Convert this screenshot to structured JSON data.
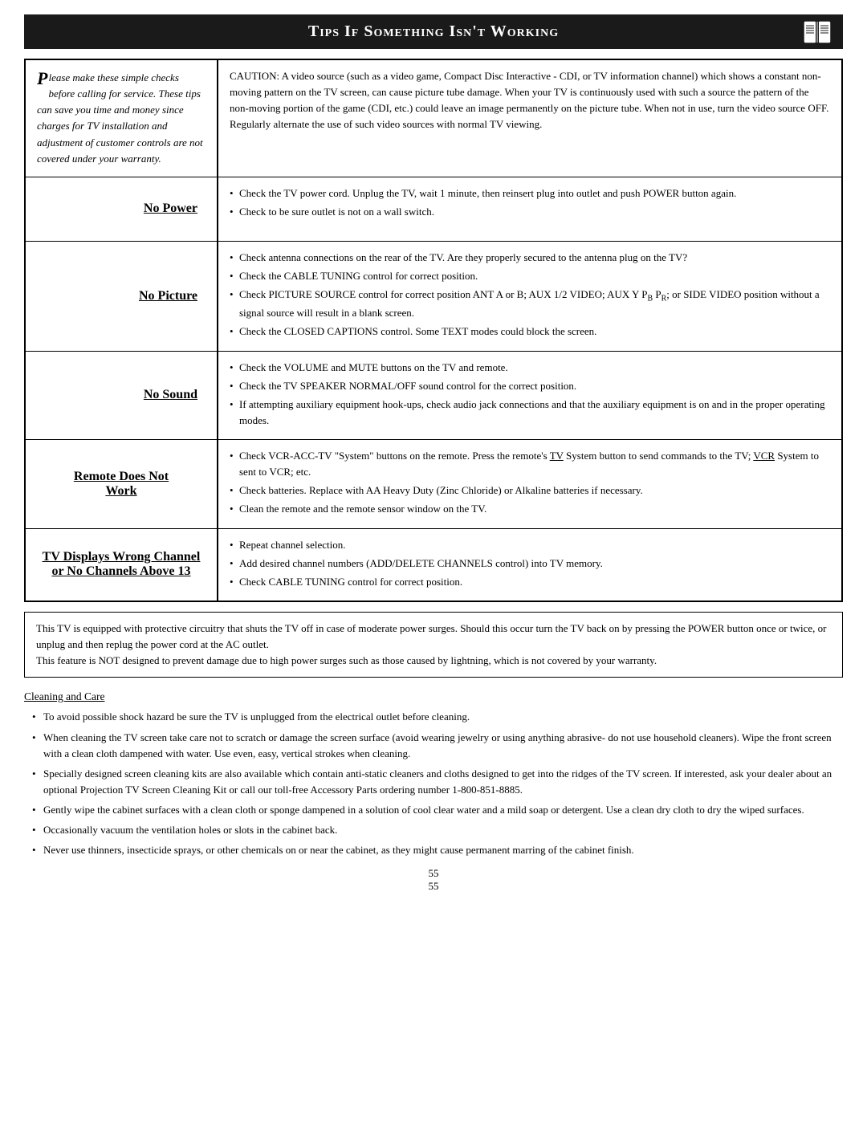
{
  "header": {
    "title": "Tips If Something Isn't Working",
    "icon_label": "book-icon"
  },
  "caution_text": "CAUTION: A video source (such as a video game, Compact Disc Interactive - CDI, or TV information channel) which shows a constant non-moving pattern on the TV screen, can cause picture tube damage. When your TV is continuously used with such a source the pattern of the non-moving portion of the game (CDI, etc.) could leave an image permanently on the picture tube. When not in use, turn the video source OFF. Regularly alternate the use of such video sources with normal TV viewing.",
  "intro": {
    "text": "lease make these simple checks before calling for service.  These tips can save you time and money since charges for TV installation and adjustment of customer controls are not covered under your warranty.",
    "drop_cap": "P"
  },
  "tips": [
    {
      "label": "No Power",
      "items": [
        "Check the TV power cord. Unplug the TV, wait 1 minute, then reinsert plug into outlet and push POWER button again.",
        "Check to be sure outlet is not on a wall switch."
      ]
    },
    {
      "label": "No Picture",
      "items": [
        "Check antenna connections on the rear of the TV. Are they properly secured to the antenna plug on the TV?",
        "Check the CABLE TUNING control for correct position.",
        "Check PICTURE SOURCE control for correct position ANT A or B; AUX 1/2 VIDEO; AUX Y PB PR; or SIDE VIDEO position without a signal source will result in a blank screen.",
        "Check the CLOSED CAPTIONS control. Some TEXT modes could block the screen."
      ]
    },
    {
      "label": "No Sound",
      "items": [
        "Check the VOLUME and MUTE buttons on the TV and remote.",
        "Check the TV SPEAKER NORMAL/OFF sound control for the correct position.",
        "If attempting auxiliary equipment hook-ups, check audio jack connections and that the auxiliary equipment is on and in the proper operating modes."
      ]
    },
    {
      "label": "Remote Does Not Work",
      "items": [
        "Check VCR-ACC-TV \"System\" buttons on the remote. Press the remote's TV System button to send commands to the TV; VCR System to sent to VCR; etc.",
        "Check batteries.  Replace with AA Heavy Duty (Zinc Chloride) or Alkaline batteries if necessary.",
        "Clean the remote and the remote sensor window on the TV."
      ]
    },
    {
      "label": "TV Displays Wrong Channel or No Channels Above 13",
      "items": [
        "Repeat channel selection.",
        "Add desired channel numbers (ADD/DELETE CHANNELS control) into TV memory.",
        "Check CABLE TUNING control for correct position."
      ]
    }
  ],
  "power_surge": {
    "text": "This TV is equipped with protective circuitry that shuts the TV off in case of moderate power surges. Should this occur turn the TV back on by pressing the POWER button once or twice, or unplug and then replug the power cord at the AC outlet.\nThis feature is NOT designed to prevent damage due to high power surges such as those caused by lightning, which is not covered by your warranty."
  },
  "cleaning": {
    "title": "Cleaning and Care",
    "items": [
      "To avoid possible shock hazard be sure the TV is unplugged from the electrical outlet before cleaning.",
      "When cleaning the TV screen take care not to scratch or damage the screen surface (avoid wearing jewelry or using anything abrasive- do not use household cleaners). Wipe the front screen with a clean cloth dampened with water.  Use even, easy, vertical strokes when cleaning.",
      "Specially designed screen cleaning kits are also available which contain anti-static cleaners and cloths designed to get into the ridges of the TV screen. If interested, ask your dealer about an optional Projection TV Screen Cleaning Kit or call our toll-free Accessory Parts ordering number 1-800-851-8885.",
      "Gently wipe the cabinet surfaces with a clean cloth or sponge dampened in a solution of cool clear water and a mild soap or detergent. Use a clean dry cloth to dry the wiped surfaces.",
      "Occasionally vacuum the ventilation holes or slots in the cabinet back.",
      "Never use thinners, insecticide sprays, or other chemicals on or near the cabinet, as they might cause permanent marring of the cabinet finish."
    ]
  },
  "page_number": "55",
  "page_number2": "55"
}
